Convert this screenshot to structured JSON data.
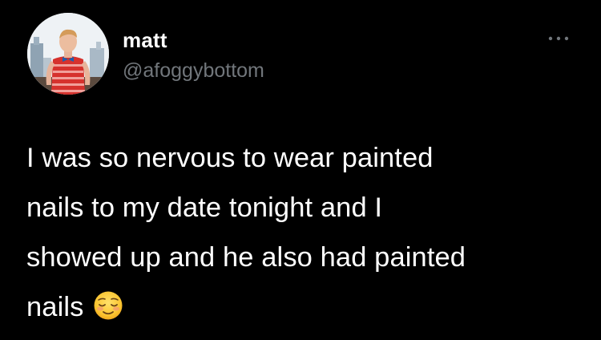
{
  "author": {
    "display_name": "matt",
    "handle": "@afoggybottom"
  },
  "tweet": {
    "text": "I was so nervous to wear painted\nnails to my date tonight and I\nshowed up and he also had painted\nnails",
    "emoji": "relieved-face"
  },
  "icons": {
    "more": "more-dots-icon"
  }
}
